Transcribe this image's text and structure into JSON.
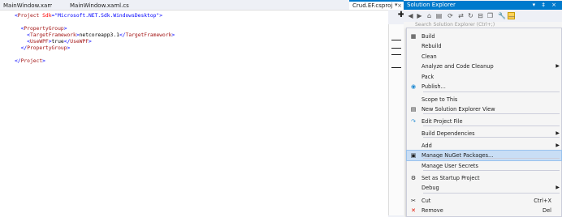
{
  "tabs": [
    {
      "label": "MainWindow.xaml",
      "active": false
    },
    {
      "label": "MainWindow.xaml.cs",
      "active": false
    },
    {
      "label": "Crud.EF.csproj",
      "active": true
    }
  ],
  "editor": {
    "lines": [
      {
        "parts": [
          [
            "bracket",
            "<"
          ],
          [
            "tag",
            "Project"
          ],
          [
            "attr",
            " Sdk"
          ],
          [
            "bracket",
            "="
          ],
          [
            "val",
            "\"Microsoft.NET.Sdk.WindowsDesktop\""
          ],
          [
            "bracket",
            ">"
          ]
        ]
      },
      {
        "parts": []
      },
      {
        "parts": [
          [
            "txt",
            "  "
          ],
          [
            "bracket",
            "<"
          ],
          [
            "tag",
            "PropertyGroup"
          ],
          [
            "bracket",
            ">"
          ]
        ]
      },
      {
        "parts": [
          [
            "txt",
            "    "
          ],
          [
            "bracket",
            "<"
          ],
          [
            "tag",
            "TargetFramework"
          ],
          [
            "bracket",
            ">"
          ],
          [
            "txt",
            "netcoreapp3.1"
          ],
          [
            "bracket",
            "</"
          ],
          [
            "tag",
            "TargetFramework"
          ],
          [
            "bracket",
            ">"
          ]
        ]
      },
      {
        "parts": [
          [
            "txt",
            "    "
          ],
          [
            "bracket",
            "<"
          ],
          [
            "tag",
            "UseWPF"
          ],
          [
            "bracket",
            ">"
          ],
          [
            "txt",
            "true"
          ],
          [
            "bracket",
            "</"
          ],
          [
            "tag",
            "UseWPF"
          ],
          [
            "bracket",
            ">"
          ]
        ]
      },
      {
        "parts": [
          [
            "txt",
            "  "
          ],
          [
            "bracket",
            "</"
          ],
          [
            "tag",
            "PropertyGroup"
          ],
          [
            "bracket",
            ">"
          ]
        ]
      },
      {
        "parts": []
      },
      {
        "parts": [
          [
            "bracket",
            "</"
          ],
          [
            "tag",
            "Project"
          ],
          [
            "bracket",
            ">"
          ]
        ]
      }
    ]
  },
  "solution_explorer": {
    "title": "Solution Explorer",
    "title_controls": "▾ ‡ ×",
    "search_placeholder": "Search Solution Explorer (Ctrl+;)"
  },
  "context_menu": {
    "items": [
      {
        "label": "Build",
        "icon": "build-icon",
        "glyph": "▦",
        "shortcut": "",
        "submenu": false
      },
      {
        "label": "Rebuild",
        "icon": "",
        "glyph": "",
        "shortcut": "",
        "submenu": false
      },
      {
        "label": "Clean",
        "icon": "",
        "glyph": "",
        "shortcut": "",
        "submenu": false
      },
      {
        "label": "Analyze and Code Cleanup",
        "icon": "",
        "glyph": "",
        "shortcut": "",
        "submenu": true
      },
      {
        "label": "Pack",
        "icon": "",
        "glyph": "",
        "shortcut": "",
        "submenu": false
      },
      {
        "label": "Publish...",
        "icon": "publish-icon",
        "glyph": "◉",
        "shortcut": "",
        "submenu": false
      },
      {
        "label": "Scope to This",
        "icon": "",
        "glyph": "",
        "shortcut": "",
        "submenu": false
      },
      {
        "label": "New Solution Explorer View",
        "icon": "new-view-icon",
        "glyph": "▤",
        "shortcut": "",
        "submenu": false
      },
      {
        "label": "Edit Project File",
        "icon": "edit-file-icon",
        "glyph": "↷",
        "shortcut": "",
        "submenu": false
      },
      {
        "label": "Build Dependencies",
        "icon": "",
        "glyph": "",
        "shortcut": "",
        "submenu": true
      },
      {
        "label": "Add",
        "icon": "",
        "glyph": "",
        "shortcut": "",
        "submenu": true
      },
      {
        "label": "Manage NuGet Packages...",
        "icon": "nuget-icon",
        "glyph": "▣",
        "shortcut": "",
        "submenu": false,
        "highlighted": true
      },
      {
        "label": "Manage User Secrets",
        "icon": "",
        "glyph": "",
        "shortcut": "",
        "submenu": false
      },
      {
        "label": "Set as Startup Project",
        "icon": "gear-icon",
        "glyph": "⚙",
        "shortcut": "",
        "submenu": false
      },
      {
        "label": "Debug",
        "icon": "",
        "glyph": "",
        "shortcut": "",
        "submenu": true
      },
      {
        "label": "Cut",
        "icon": "scissors-icon",
        "glyph": "✂",
        "shortcut": "Ctrl+X",
        "submenu": false
      },
      {
        "label": "Remove",
        "icon": "remove-icon",
        "glyph": "✕",
        "shortcut": "Del",
        "submenu": false
      }
    ]
  },
  "colors": {
    "accent": "#007acc",
    "highlight": "#c9def5",
    "remove_icon": "#e51400",
    "publish_icon": "#1f8ad2"
  }
}
